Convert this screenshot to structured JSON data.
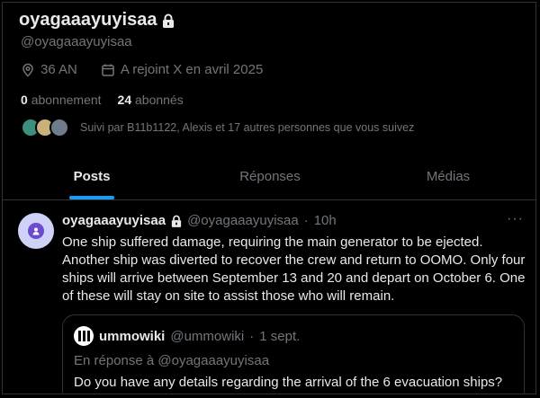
{
  "profile": {
    "display_name": "oyagaaayuyisaa",
    "handle": "@oyagaaayuyisaa",
    "age": "36 AN",
    "joined": "A rejoint X en avril 2025",
    "following_count": "0",
    "following_label": "abonnement",
    "followers_count": "24",
    "followers_label": "abonnés",
    "followed_by": "Suivi par B11b1122, Alexis et 17 autres personnes que vous suivez"
  },
  "tabs": [
    {
      "label": "Posts"
    },
    {
      "label": "Réponses"
    },
    {
      "label": "Médias"
    }
  ],
  "tweet": {
    "name": "oyagaaayuyisaa",
    "handle": "@oyagaaayuyisaa",
    "separator": "·",
    "time": "10h",
    "more": "···",
    "text": "One ship suffered damage, requiring the main generator to be ejected. Another ship was diverted to recover the crew and return to OOMO. Only four ships will arrive between September 13 and 20 and depart on October 6. One of these will stay on site to assist those who will remain.",
    "quote": {
      "name": "ummowiki",
      "handle": "@ummowiki",
      "separator": "·",
      "time": "1 sept.",
      "reply_to": "En réponse à @oyagaaayuyisaa",
      "text": "Do you have any details regarding the arrival of the 6 evacuation ships?"
    }
  },
  "colors": {
    "accent": "#1d9bf0",
    "muted": "#71767b",
    "text": "#e7e9ea",
    "border": "#2f3336"
  }
}
